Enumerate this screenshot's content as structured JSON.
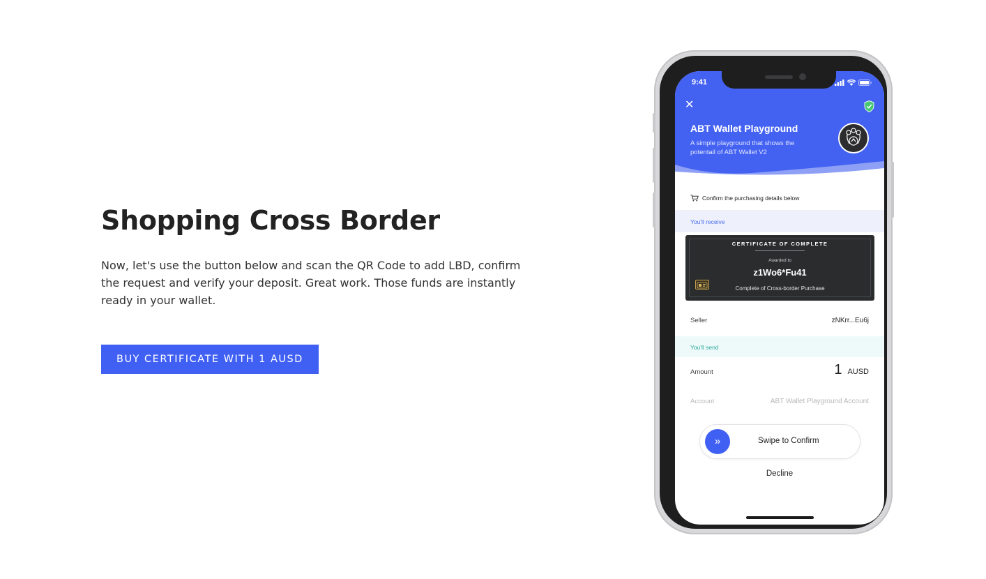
{
  "hero": {
    "title": "Shopping Cross Border",
    "description": "Now, let's use the button below and scan the QR Code to add LBD, confirm the request and verify your deposit. Great work. Those funds are instantly ready in your wallet.",
    "cta_label": "BUY CERTIFICATE WITH 1 AUSD"
  },
  "phone": {
    "status_time": "9:41",
    "app": {
      "title": "ABT Wallet Playground",
      "description": "A simple playground that shows the potentail of ABT Wallet V2"
    },
    "confirm_text": "Confirm the purchasing details below",
    "receive_label": "You'll receive",
    "certificate": {
      "title": "CERTIFICATE OF COMPLETE",
      "awarded_to_label": "Awarded to",
      "recipient": "z1Wo6*Fu41",
      "subtitle": "Complete of Cross-border Purchase"
    },
    "seller": {
      "label": "Seller",
      "value": "zNKrr...Eu6j"
    },
    "send_label": "You'll send",
    "amount": {
      "label": "Amount",
      "value": "1",
      "unit": "AUSD"
    },
    "account": {
      "label": "Account",
      "value": "ABT Wallet Playground Account"
    },
    "swipe_label": "Swipe to Confirm",
    "swipe_glyph": "»",
    "decline_label": "Decline",
    "close_glyph": "✕"
  },
  "colors": {
    "accent": "#4060f4",
    "header_blue": "#4462f2",
    "send_green": "#2aa79b",
    "certificate_bg": "#2b2c2e"
  }
}
